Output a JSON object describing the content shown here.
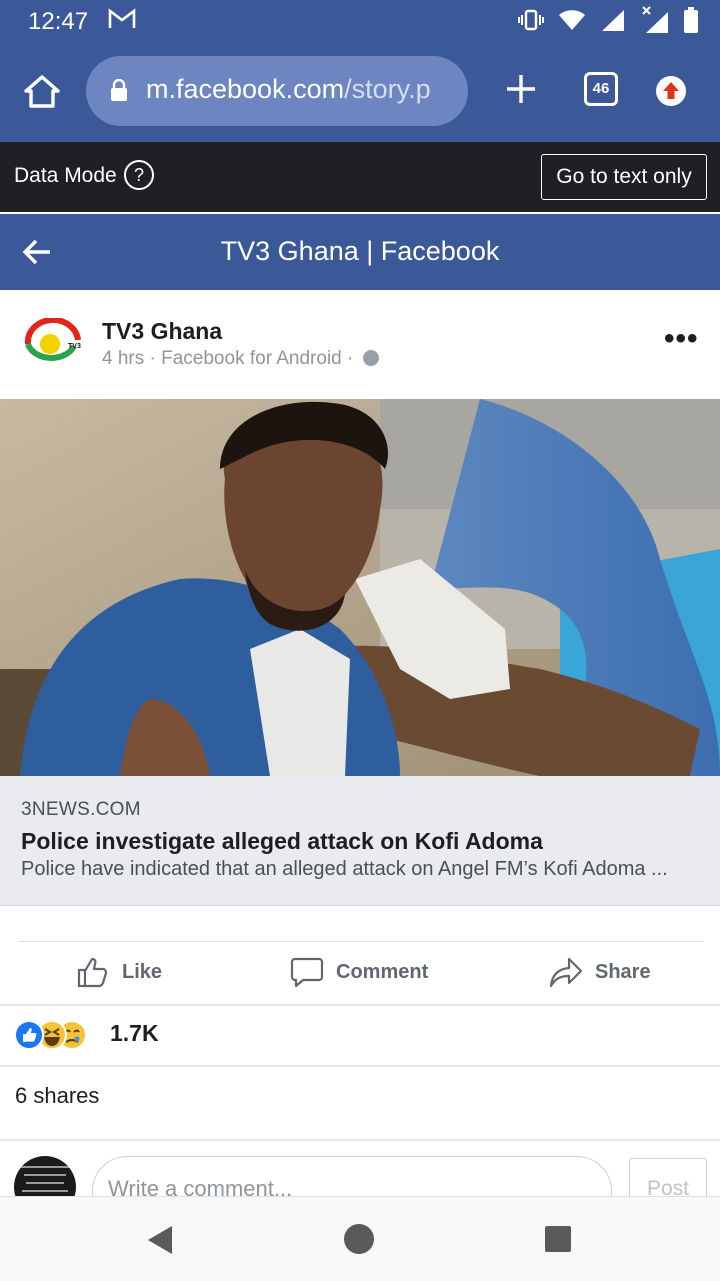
{
  "status_bar": {
    "time": "12:47"
  },
  "browser": {
    "url_host": "m.facebook.com",
    "url_path": "/story.p",
    "tab_count": "46"
  },
  "data_mode": {
    "label": "Data Mode",
    "help": "?",
    "text_only_button": "Go to text only"
  },
  "page": {
    "title": "TV3 Ghana | Facebook"
  },
  "post": {
    "author": "TV3 Ghana",
    "meta": "4 hrs · Facebook for Android ·",
    "logo_text": "TV3"
  },
  "link": {
    "domain": "3NEWS.COM",
    "title": "Police investigate alleged attack on Kofi Adoma",
    "description": "Police have indicated that an alleged attack on Angel FM’s Kofi Adoma ..."
  },
  "actions": {
    "like": "Like",
    "comment": "Comment",
    "share": "Share"
  },
  "reactions": {
    "count": "1.7K"
  },
  "shares": "6 shares",
  "comment_box": {
    "placeholder": "Write a comment...",
    "post_button": "Post"
  },
  "colors": {
    "facebook_blue": "#3b5998",
    "data_mode_bg": "#1e2024",
    "link_bg": "#e9ebee"
  }
}
